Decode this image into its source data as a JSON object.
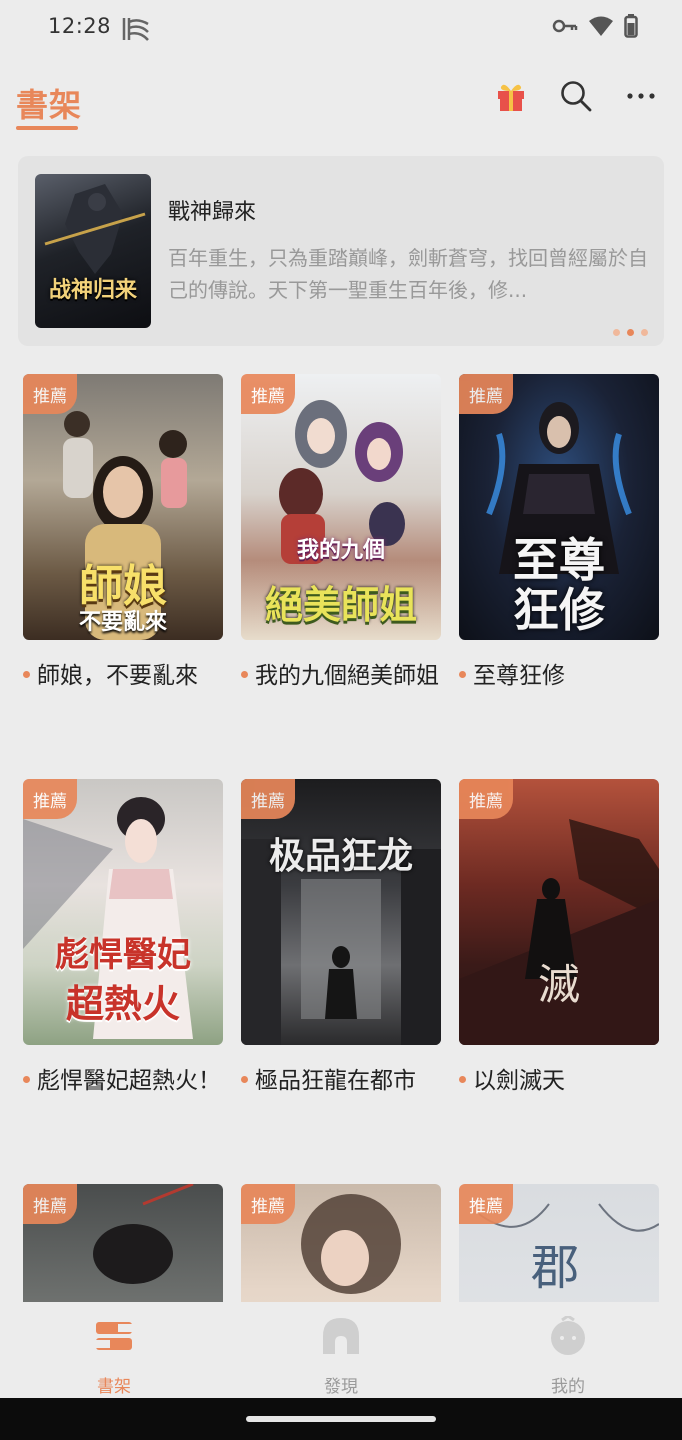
{
  "status": {
    "time": "12:28"
  },
  "header": {
    "shelf_tab": "書架"
  },
  "banner": {
    "title": "戰神歸來",
    "description": "百年重生，只為重踏巔峰，劍斬蒼穹，找回曾經屬於自己的傳說。天下第一聖重生百年後，修...",
    "cover_text": "战神归来",
    "page_count": 3,
    "active_page": 2
  },
  "badge_label": "推薦",
  "books": [
    {
      "title": "師娘，不要亂來",
      "cover_text": "師娘",
      "cover_sub": "不要亂來"
    },
    {
      "title": "我的九個絕美師姐",
      "cover_text": "絕美師姐",
      "cover_sub": "我的九個"
    },
    {
      "title": "至尊狂修",
      "cover_text": "至尊",
      "cover_sub": "狂修"
    },
    {
      "title": "彪悍醫妃超熱火！",
      "cover_text": "彪悍醫妃",
      "cover_sub": "超熱火"
    },
    {
      "title": "極品狂龍在都市",
      "cover_text": "极品狂龙",
      "cover_sub": ""
    },
    {
      "title": "以劍滅天",
      "cover_text": "",
      "cover_sub": ""
    },
    {
      "title": "",
      "cover_text": "",
      "cover_sub": ""
    },
    {
      "title": "",
      "cover_text": "",
      "cover_sub": ""
    },
    {
      "title": "",
      "cover_text": "",
      "cover_sub": ""
    }
  ],
  "nav": [
    {
      "label": "書架",
      "icon": "bookshelf-icon",
      "active": true
    },
    {
      "label": "發現",
      "icon": "discover-icon",
      "active": false
    },
    {
      "label": "我的",
      "icon": "profile-icon",
      "active": false
    }
  ],
  "colors": {
    "accent": "#e8875a",
    "background": "#ececec",
    "muted": "#9a9a9a"
  }
}
